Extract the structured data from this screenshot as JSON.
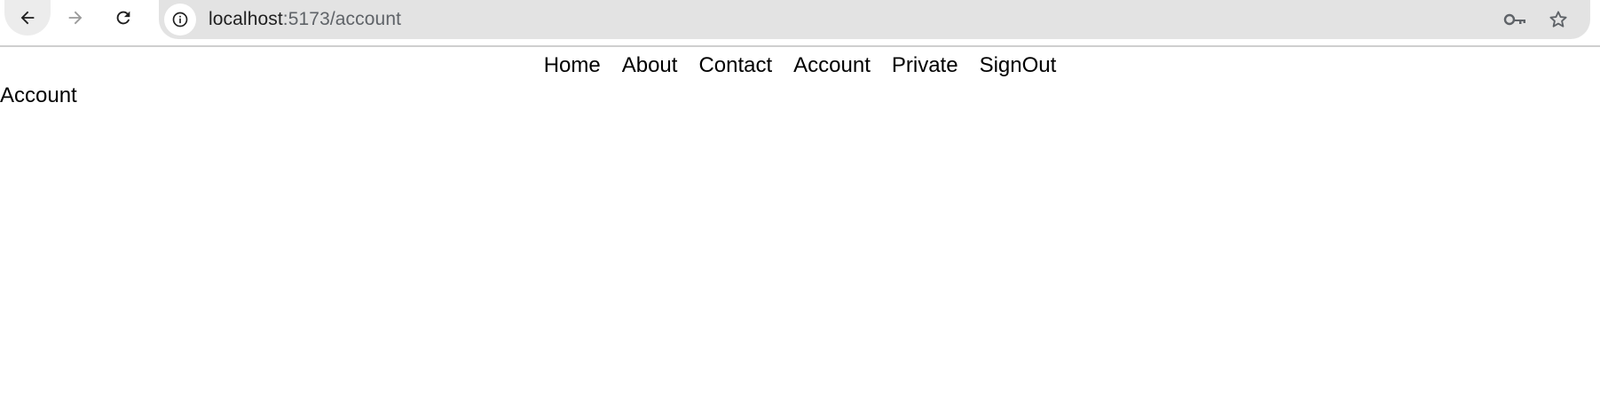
{
  "browser": {
    "url_host": "localhost",
    "url_path": ":5173/account",
    "back_icon": "arrow-left-icon",
    "forward_icon": "arrow-right-icon",
    "reload_icon": "reload-icon",
    "site_info_icon": "info-icon",
    "password_icon": "key-icon",
    "bookmark_icon": "star-icon"
  },
  "nav": {
    "items": [
      {
        "label": "Home"
      },
      {
        "label": "About"
      },
      {
        "label": "Contact"
      },
      {
        "label": "Account"
      },
      {
        "label": "Private"
      },
      {
        "label": "SignOut"
      }
    ]
  },
  "main": {
    "heading": "Account"
  }
}
